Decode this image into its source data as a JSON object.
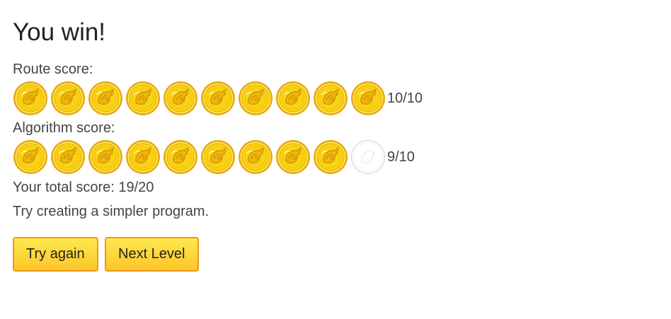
{
  "title": "You win!",
  "route": {
    "label": "Route score:",
    "earned": 10,
    "max": 10,
    "fraction_text": "10/10"
  },
  "algorithm": {
    "label": "Algorithm score:",
    "earned": 9,
    "max": 10,
    "fraction_text": "9/10"
  },
  "total_text": "Your total score: 19/20",
  "message": "Try creating a simpler program.",
  "buttons": {
    "try_again": "Try again",
    "next_level": "Next Level"
  },
  "colors": {
    "coin_gold": "#f9d313",
    "coin_rim": "#e8a90f",
    "coin_empty_outline": "#aaaaaa",
    "button_border": "#f0961f",
    "button_fill": "#fdd835"
  },
  "icons": {
    "earned": "gold-coin-icon",
    "missing": "empty-coin-icon"
  }
}
